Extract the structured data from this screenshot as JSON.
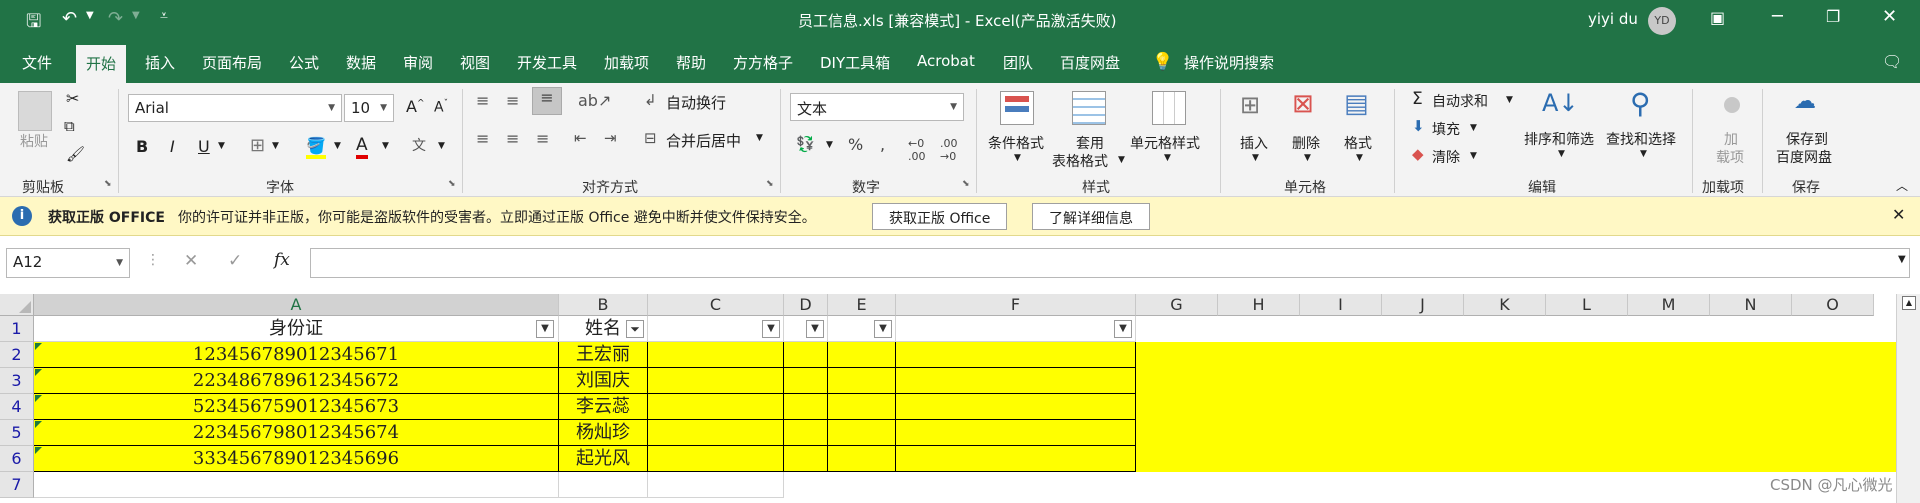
{
  "titlebar": {
    "title": "员工信息.xls  [兼容模式]  -  Excel(产品激活失败)",
    "user": "yiyi du",
    "avatar": "YD"
  },
  "menu": [
    "文件",
    "开始",
    "插入",
    "页面布局",
    "公式",
    "数据",
    "审阅",
    "视图",
    "开发工具",
    "加载项",
    "帮助",
    "方方格子",
    "DIY工具箱",
    "Acrobat",
    "团队",
    "百度网盘"
  ],
  "tell_me": "操作说明搜索",
  "ribbon": {
    "clipboard": {
      "paste": "粘贴",
      "label": "剪贴板"
    },
    "font": {
      "name": "Arial",
      "size": "10",
      "label": "字体"
    },
    "align": {
      "wrap": "自动换行",
      "merge": "合并后居中",
      "label": "对齐方式"
    },
    "number": {
      "format": "文本",
      "label": "数字"
    },
    "styles": {
      "cond": "条件格式",
      "table1": "套用",
      "table2": "表格格式",
      "cell": "单元格样式",
      "label": "样式"
    },
    "cells": {
      "insert": "插入",
      "delete": "删除",
      "format": "格式",
      "label": "单元格"
    },
    "editing": {
      "autosum": "自动求和",
      "fill": "填充",
      "clear": "清除",
      "sort": "排序和筛选",
      "find": "查找和选择",
      "label": "编辑"
    },
    "addins": {
      "btn1": "加",
      "btn2": "载项",
      "label": "加载项"
    },
    "save": {
      "btn1": "保存到",
      "btn2": "百度网盘",
      "label": "保存"
    }
  },
  "message": {
    "title": "获取正版 OFFICE",
    "text": "你的许可证并非正版，你可能是盗版软件的受害者。立即通过正版 Office 避免中断并使文件保持安全。",
    "btn1": "获取正版 Office",
    "btn2": "了解详细信息"
  },
  "formula": {
    "namebox": "A12",
    "fx": "fx",
    "value": ""
  },
  "columns": [
    "A",
    "B",
    "C",
    "D",
    "E",
    "F",
    "G",
    "H",
    "I",
    "J",
    "K",
    "L",
    "M",
    "N",
    "O"
  ],
  "rows": [
    "1",
    "2",
    "3",
    "4",
    "5",
    "6",
    "7"
  ],
  "header_row": {
    "a": "身份证",
    "b": "姓名"
  },
  "data": [
    {
      "id": "123456789012345671",
      "name": "王宏丽"
    },
    {
      "id": "223486789612345672",
      "name": "刘国庆"
    },
    {
      "id": "523456759012345673",
      "name": "李云蕊"
    },
    {
      "id": "223456798012345674",
      "name": "杨灿珍"
    },
    {
      "id": "333456789012345696",
      "name": "起光风"
    }
  ],
  "watermark": "CSDN @凡心微光",
  "colors": {
    "excel_green": "#217346",
    "highlight": "#ffff00",
    "message_bar": "#fff8c5"
  }
}
